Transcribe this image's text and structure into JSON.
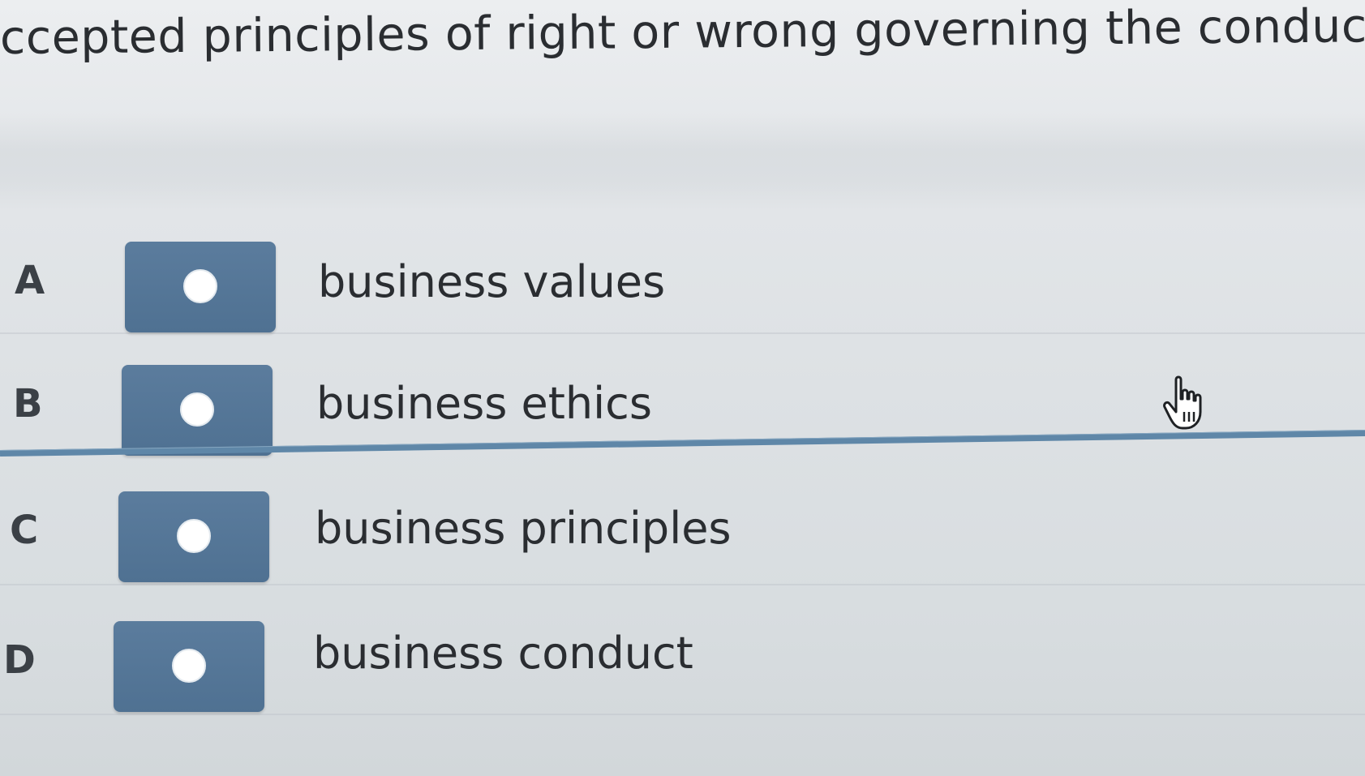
{
  "question": {
    "text": "ccepted principles of right or wrong governing the conduct of bu"
  },
  "options": [
    {
      "letter": "A",
      "label": "business values"
    },
    {
      "letter": "B",
      "label": "business ethics"
    },
    {
      "letter": "C",
      "label": "business principles"
    },
    {
      "letter": "D",
      "label": "business conduct"
    }
  ],
  "colors": {
    "button": "#52749a",
    "separator": "#5f87a8",
    "text": "#2a2d31"
  },
  "cursor": {
    "icon": "hand-pointer-icon"
  }
}
